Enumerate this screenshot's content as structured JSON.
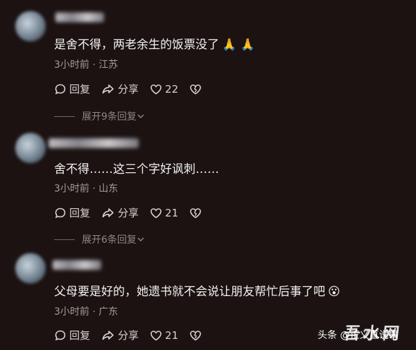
{
  "comments": [
    {
      "text": "是舍不得，两老余生的饭票没了",
      "emoji": "🙏 🙏",
      "meta": "3小时前 · 江苏",
      "reply_label": "回复",
      "share_label": "分享",
      "like_count": "22",
      "expand_label": "展开9条回复"
    },
    {
      "text": "舍不得……这三个字好讽刺……",
      "emoji": "",
      "meta": "3小时前 · 山东",
      "reply_label": "回复",
      "share_label": "分享",
      "like_count": "21",
      "expand_label": "展开6条回复"
    },
    {
      "text": "父母要是好的，她遗书就不会说让朋友帮忙后事了吧",
      "emoji": "😮",
      "meta": "3小时前 · 广东",
      "reply_label": "回复",
      "share_label": "分享",
      "like_count": "21",
      "expand_label": ""
    }
  ],
  "watermark": {
    "source": "头条 @正义直说事",
    "logo": "吾水网"
  },
  "colors": {
    "background": "#1c1212",
    "text": "#f2f2f2",
    "meta": "#a39d9d"
  }
}
